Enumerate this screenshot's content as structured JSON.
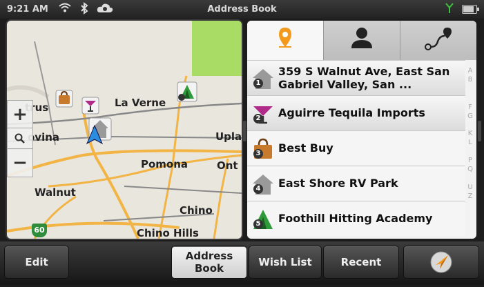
{
  "statusbar": {
    "time": "9:21 AM",
    "title": "Address Book",
    "icons": [
      "wifi-icon",
      "bluetooth-icon",
      "cloud-sync-icon",
      "signal-icon",
      "battery-icon"
    ]
  },
  "map": {
    "cities": [
      "trus",
      "La Verne",
      "ovina",
      "Upla",
      "Pomona",
      "Ont",
      "Walnut",
      "Chino",
      "Chino Hills"
    ],
    "highway_shield": "60",
    "zoom": {
      "in": "+",
      "out": "−"
    }
  },
  "tabs": [
    {
      "name": "places-tab",
      "icon": "location-pin-icon",
      "active": true
    },
    {
      "name": "contacts-tab",
      "icon": "person-icon",
      "active": false
    },
    {
      "name": "routes-tab",
      "icon": "route-icon",
      "active": false
    }
  ],
  "list": [
    {
      "num": "1",
      "icon": "home-icon",
      "label": "359 S Walnut Ave, East San Gabriel Valley, San ..."
    },
    {
      "num": "2",
      "icon": "cocktail-icon",
      "label": "Aguirre Tequila Imports"
    },
    {
      "num": "3",
      "icon": "shopping-bag-icon",
      "label": "Best Buy"
    },
    {
      "num": "4",
      "icon": "home-icon",
      "label": "East Shore RV Park"
    },
    {
      "num": "5",
      "icon": "tent-icon",
      "label": "Foothill Hitting Academy"
    }
  ],
  "alpha_index": [
    "A",
    "B",
    "",
    "F",
    "G",
    "",
    "K",
    "L",
    "",
    "P",
    "Q",
    "",
    "U",
    "Z"
  ],
  "bottom": {
    "edit": "Edit",
    "address_book_line1": "Address",
    "address_book_line2": "Book",
    "wish_list": "Wish List",
    "recent": "Recent",
    "navigate_icon": "compass-arrow-icon"
  },
  "colors": {
    "accent_orange": "#f39a1e",
    "map_green": "#a8dc64",
    "road_orange": "#f2b445"
  }
}
